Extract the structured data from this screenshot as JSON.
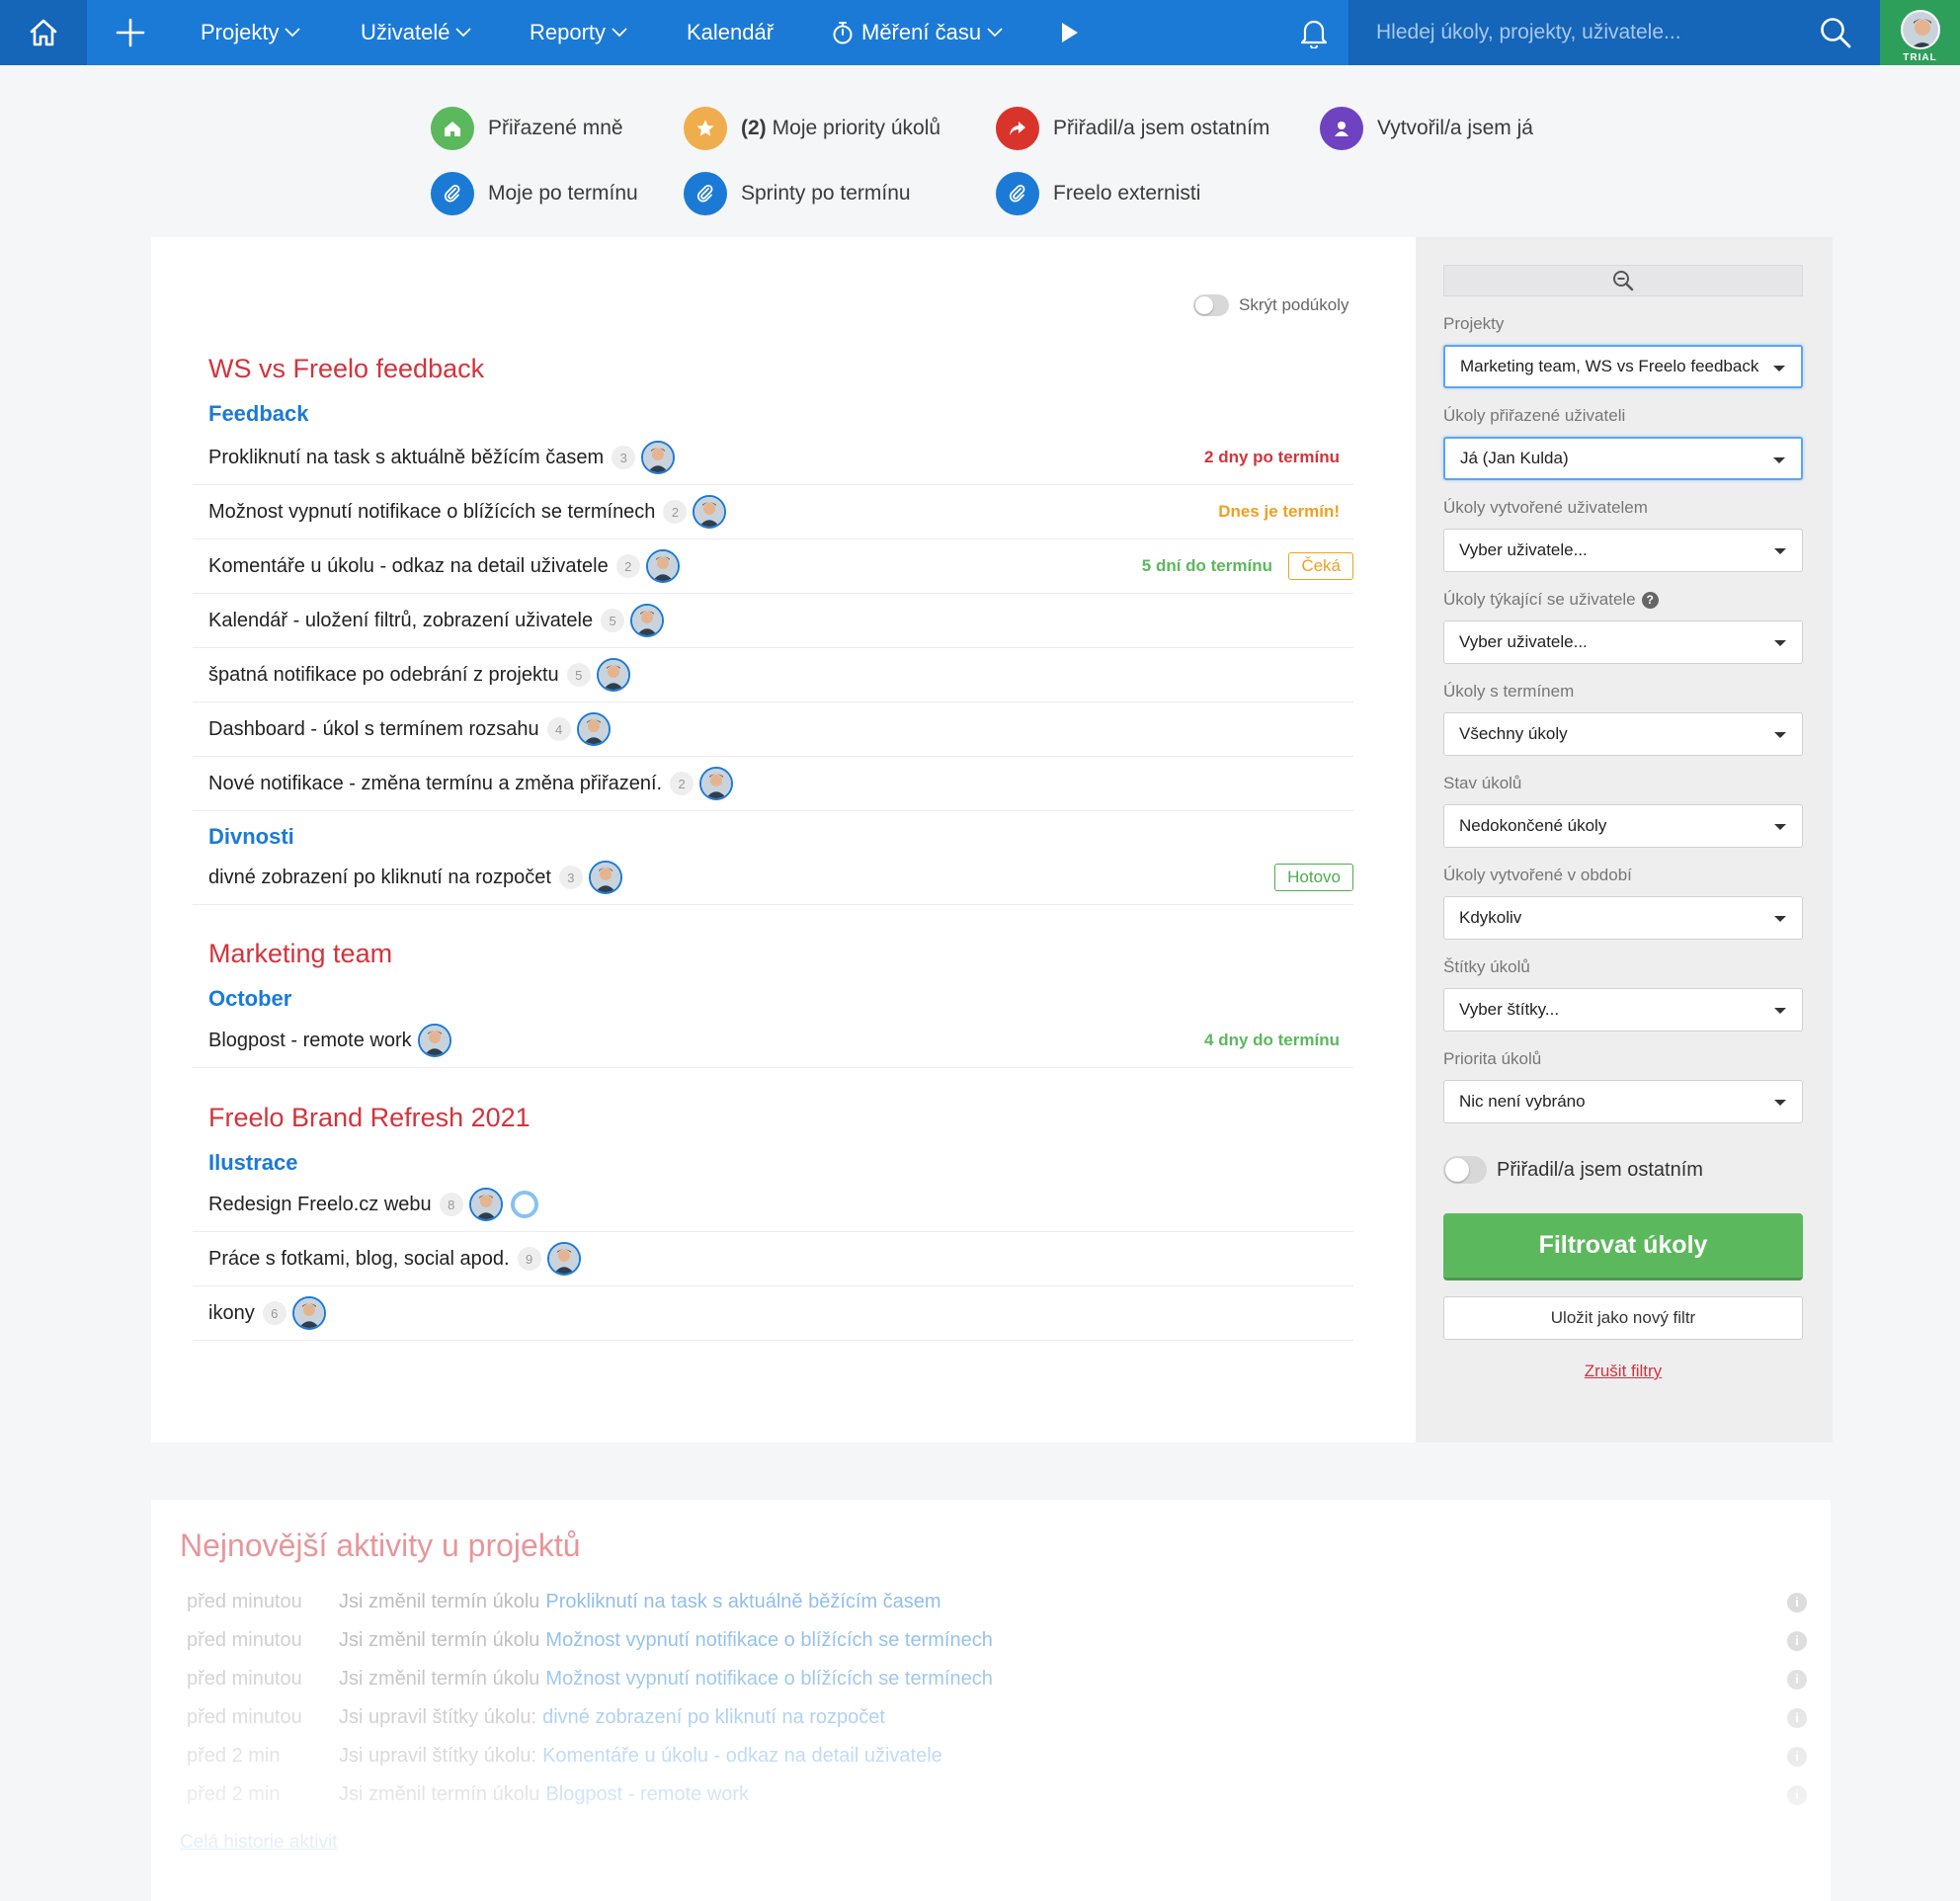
{
  "nav": {
    "items": [
      {
        "label": "Projekty",
        "dropdown": true
      },
      {
        "label": "Uživatelé",
        "dropdown": true
      },
      {
        "label": "Reporty",
        "dropdown": true
      },
      {
        "label": "Kalendář",
        "dropdown": false
      },
      {
        "label": "Měření času",
        "dropdown": true
      }
    ],
    "search_placeholder": "Hledej úkoly, projekty, uživatele...",
    "trial_badge": "TRIAL",
    "icons": [
      "home-icon",
      "plus-icon",
      "play-icon",
      "bell-icon",
      "search-icon",
      "stopwatch-icon"
    ]
  },
  "quick_filters": [
    {
      "label": "Přiřazené mně",
      "color": "#5cb85c",
      "icon": "home-icon"
    },
    {
      "count": "(2)",
      "label": "Moje priority úkolů",
      "color": "#f0ad4e",
      "icon": "star-icon"
    },
    {
      "label": "Přiřadil/a jsem ostatním",
      "color": "#d9342b",
      "icon": "share-icon"
    },
    {
      "label": "Vytvořil/a jsem já",
      "color": "#6f42c1",
      "icon": "user-icon"
    },
    {
      "label": "Moje po termínu",
      "color": "#1b7ad6",
      "icon": "paperclip-icon"
    },
    {
      "label": "Sprinty po termínu",
      "color": "#1b7ad6",
      "icon": "paperclip-icon"
    },
    {
      "label": "Freelo externisti",
      "color": "#1b7ad6",
      "icon": "paperclip-icon"
    }
  ],
  "main": {
    "hide_subtasks_label": "Skrýt podúkoly",
    "projects": [
      {
        "title": "WS vs Freelo feedback",
        "lists": [
          {
            "title": "Feedback",
            "tasks": [
              {
                "name": "Prokliknutí na task s aktuálně běžícím časem",
                "count": "3",
                "due": "2 dny po termínu",
                "due_color": "#d2343c"
              },
              {
                "name": "Možnost vypnutí notifikace o blížících se termínech",
                "count": "2",
                "due": "Dnes je termín!",
                "due_color": "#f0a020"
              },
              {
                "name": "Komentáře u úkolu - odkaz na detail uživatele",
                "count": "2",
                "due": "5 dní do termínu",
                "due_color": "#5cb85c",
                "badge": "Čeká",
                "badge_color": "#f0a020"
              },
              {
                "name": "Kalendář - uložení filtrů, zobrazení uživatele",
                "count": "5"
              },
              {
                "name": "špatná notifikace po odebrání z projektu",
                "count": "5"
              },
              {
                "name": "Dashboard - úkol s termínem rozsahu",
                "count": "4"
              },
              {
                "name": "Nové notifikace - změna termínu a změna přiřazení.",
                "count": "2"
              }
            ]
          },
          {
            "title": "Divnosti",
            "tasks": [
              {
                "name": "divné zobrazení po kliknutí na rozpočet",
                "count": "3",
                "badge": "Hotovo",
                "badge_color": "#4cae4c"
              }
            ]
          }
        ]
      },
      {
        "title": "Marketing team",
        "lists": [
          {
            "title": "October",
            "tasks": [
              {
                "name": "Blogpost - remote work",
                "due": "4 dny do termínu",
                "due_color": "#5cb85c"
              }
            ]
          }
        ]
      },
      {
        "title": "Freelo Brand Refresh 2021",
        "lists": [
          {
            "title": "Ilustrace",
            "tasks": [
              {
                "name": "Redesign Freelo.cz webu",
                "count": "8"
              },
              {
                "name": "Práce s fotkami, blog, social apod.",
                "count": "9"
              },
              {
                "name": "ikony",
                "count": "6"
              }
            ]
          }
        ]
      }
    ]
  },
  "sidebar": {
    "filters": [
      {
        "label": "Projekty",
        "value": "Marketing team, WS vs Freelo feedback"
      },
      {
        "label": "Úkoly přiřazené uživateli",
        "value": "Já (Jan Kulda)"
      },
      {
        "label": "Úkoly vytvořené uživatelem",
        "value": "Vyber uživatele..."
      },
      {
        "label": "Úkoly týkající se uživatele",
        "value": "Vyber uživatele..."
      },
      {
        "label": "Úkoly s termínem",
        "value": "Všechny úkoly"
      },
      {
        "label": "Stav úkolů",
        "value": "Nedokončené úkoly"
      },
      {
        "label": "Úkoly vytvořené v období",
        "value": "Kdykoliv"
      },
      {
        "label": "Štítky úkolů",
        "value": "Vyber štítky..."
      },
      {
        "label": "Priorita úkolů",
        "value": "Nic není vybráno"
      }
    ],
    "assigned_to_others_toggle": "Přiřadil/a jsem ostatním",
    "filter_button": "Filtrovat úkoly",
    "save_button": "Uložit jako nový filtr",
    "cancel_link": "Zrušit filtry"
  },
  "activity": {
    "title": "Nejnovější aktivity u projektů",
    "rows": [
      {
        "time": "před minutou",
        "text": "Jsi změnil termín úkolu",
        "link": "Prokliknutí na task s aktuálně běžícím časem"
      },
      {
        "time": "před minutou",
        "text": "Jsi změnil termín úkolu",
        "link": "Možnost vypnutí notifikace o blížících se termínech"
      },
      {
        "time": "před minutou",
        "text": "Jsi změnil termín úkolu",
        "link": "Možnost vypnutí notifikace o blížících se termínech"
      },
      {
        "time": "před minutou",
        "text": "Jsi upravil štítky úkolu:",
        "link": "divné zobrazení po kliknutí na rozpočet"
      },
      {
        "time": "před 2 min",
        "text": "Jsi upravil štítky úkolu:",
        "link": "Komentáře u úkolu - odkaz na detail uživatele"
      },
      {
        "time": "před 2 min",
        "text": "Jsi změnil termín úkolu",
        "link": "Blogpost - remote work"
      }
    ],
    "history_link": "Celá historie aktivit"
  }
}
